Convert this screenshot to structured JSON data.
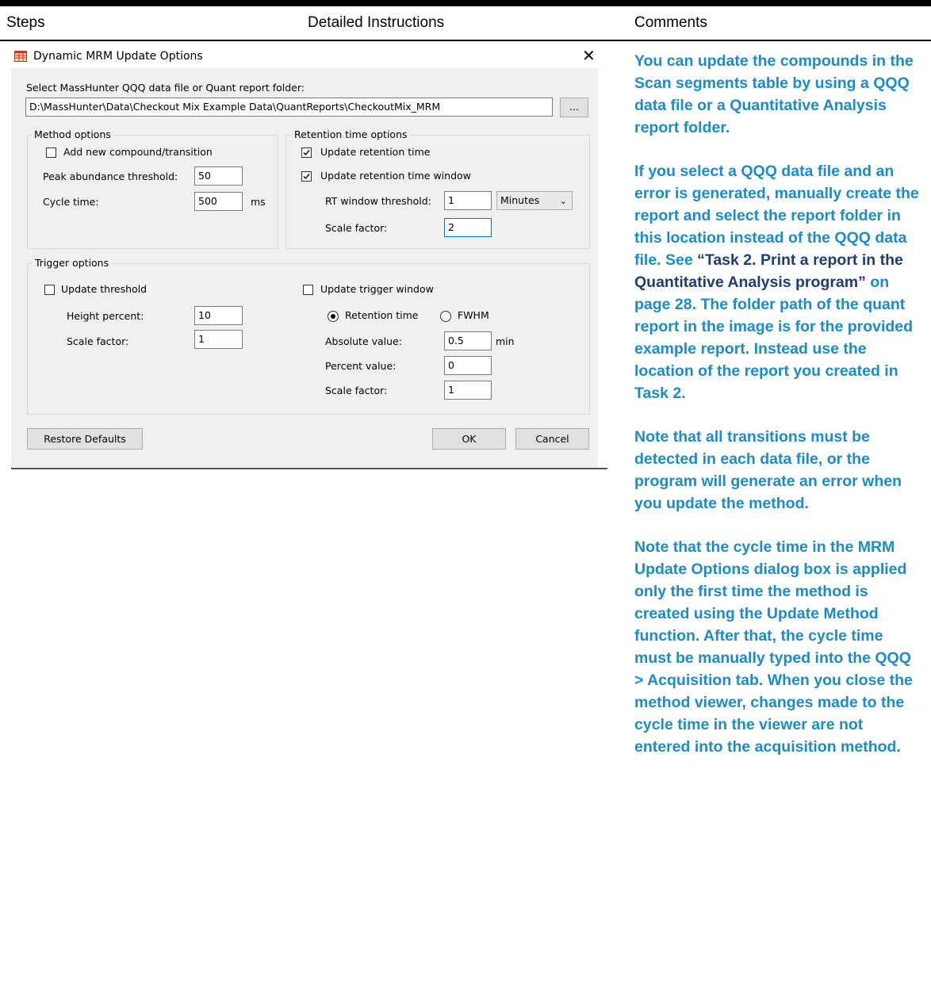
{
  "table_header": {
    "col1": "Steps",
    "col2": "Detailed Instructions",
    "col3": "Comments"
  },
  "dialog": {
    "title": "Dynamic MRM Update Options",
    "close_glyph": "✕",
    "file_label": "Select MassHunter QQQ data file or Quant report folder:",
    "file_path": "D:\\MassHunter\\Data\\Checkout Mix Example Data\\QuantReports\\CheckoutMix_MRM",
    "browse_label": "...",
    "method_options": {
      "title": "Method options",
      "add_new_label": "Add new compound/transition",
      "add_new_checked": false,
      "peak_label": "Peak abundance threshold:",
      "peak_value": "50",
      "cycle_label": "Cycle time:",
      "cycle_value": "500",
      "cycle_unit": "ms"
    },
    "rt_options": {
      "title": "Retention time options",
      "update_rt_label": "Update retention time",
      "update_rt_checked": true,
      "update_rt_window_label": "Update retention time window",
      "update_rt_window_checked": true,
      "rt_threshold_label": "RT window threshold:",
      "rt_threshold_value": "1",
      "unit_selected": "Minutes",
      "scale_label": "Scale factor:",
      "scale_value": "2"
    },
    "trigger_options": {
      "title": "Trigger options",
      "update_threshold_label": "Update threshold",
      "update_threshold_checked": false,
      "height_label": "Height percent:",
      "height_value": "10",
      "scale_label": "Scale factor:",
      "scale_value": "1",
      "update_trigger_window_label": "Update trigger window",
      "update_trigger_window_checked": false,
      "radio_rt_label": "Retention time",
      "radio_fwhm_label": "FWHM",
      "radio_selected": "Retention time",
      "abs_label": "Absolute value:",
      "abs_value": "0.5",
      "abs_unit": "min",
      "pct_label": "Percent value:",
      "pct_value": "0",
      "scale2_label": "Scale factor:",
      "scale2_value": "1"
    },
    "restore_label": "Restore Defaults",
    "ok_label": "OK",
    "cancel_label": "Cancel"
  },
  "comments": {
    "p1": "You can update the compounds in the Scan segments table by using a QQQ data file or a Quantitative Analysis report folder.",
    "p2a": "If you select a QQQ data file and an error is generated, manually create the report and select the report folder in this location instead of the QQQ data file. See ",
    "p2_link": "“Task 2. Print a report in the Quantitative Analysis program”",
    "p2b": " on page 28. The folder path of the quant report in the image is for the provided example report. Instead use the location of the report you created in Task 2.",
    "p3": "Note that all transitions must be detected in each data file, or the program will generate an error when you update the method.",
    "p4": "Note that the cycle time in the MRM Update Options dialog box is applied only the first time the method is created using the Update Method function. After that, the cycle time must be manually typed into the QQQ > Acquisition tab. When you close the method viewer, changes made to the cycle time in the viewer are not entered into the acquisition method."
  },
  "colors": {
    "comment_blue": "#1a8bd1",
    "link_dark": "#1d3c7a",
    "dialog_bg": "#f0f0f0",
    "focus_border": "#0078d7"
  },
  "icons": [
    "app-icon",
    "close-icon",
    "checkbox-checked-icon",
    "chevron-down-icon",
    "radio-selected-icon"
  ]
}
